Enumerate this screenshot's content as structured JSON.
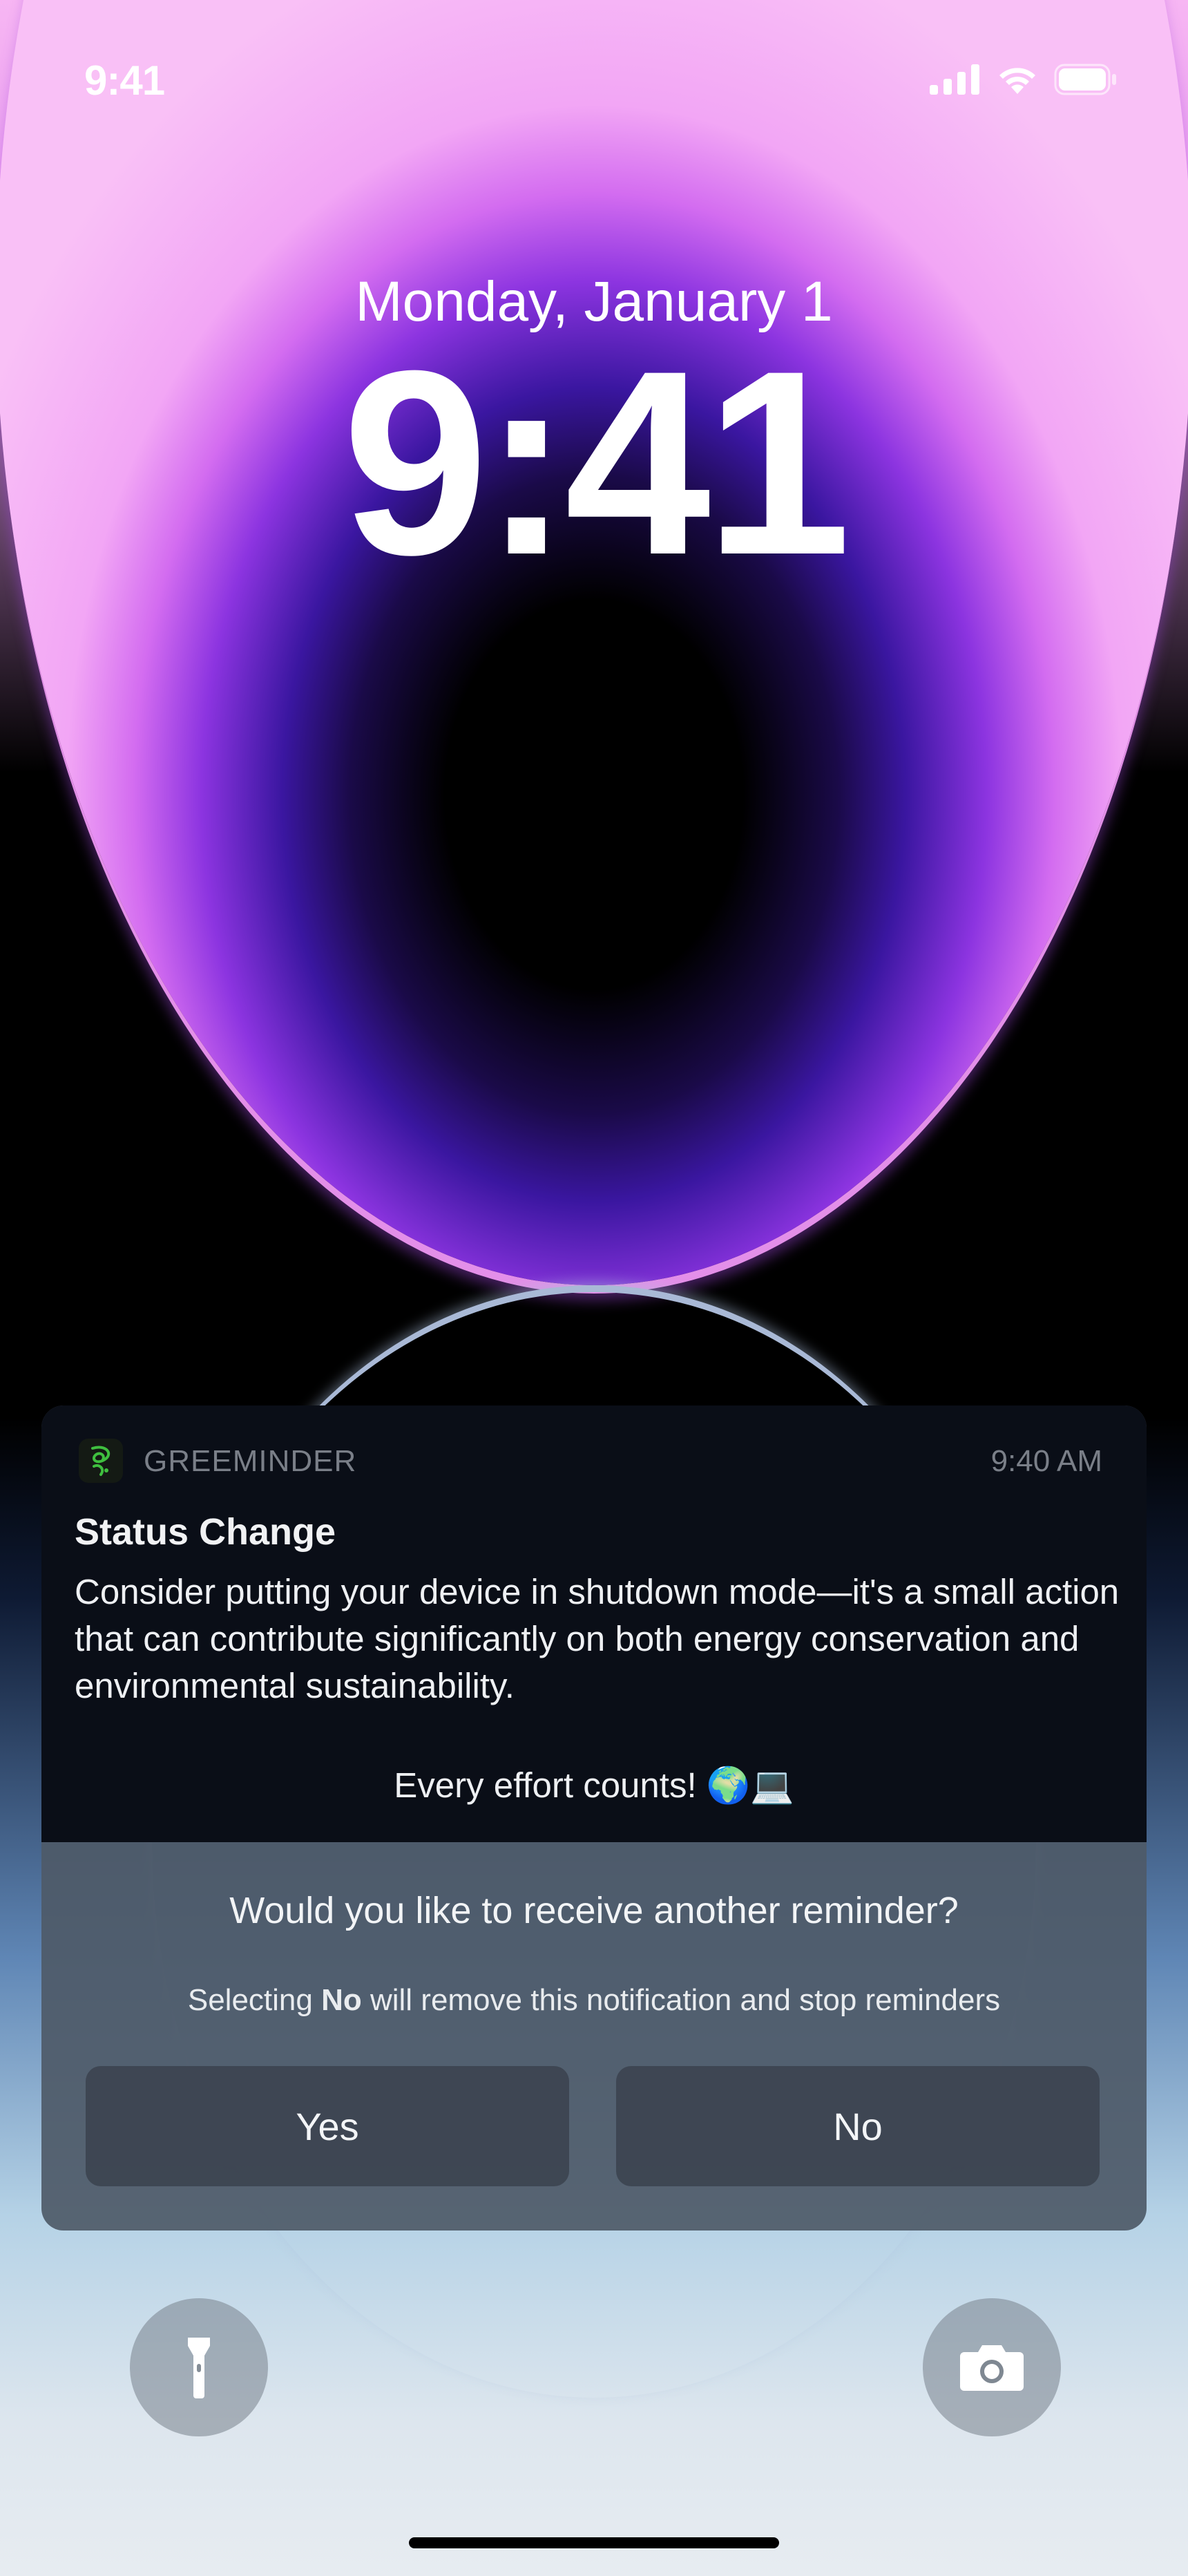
{
  "status_bar": {
    "time": "9:41"
  },
  "lock": {
    "date": "Monday, January 1",
    "time": "9:41"
  },
  "notification": {
    "app_name": "GREEMINDER",
    "time": "9:40 AM",
    "title": "Status Change",
    "body": "Consider putting your device in shutdown mode—it's a small action that can contribute significantly on both energy conservation and environmental sustainability.",
    "extra": "Every effort counts! 🌍💻",
    "question": "Would you like to receive another reminder?",
    "hint_prefix": "Selecting ",
    "hint_bold": "No",
    "hint_suffix": " will remove this notification and stop reminders",
    "yes_label": "Yes",
    "no_label": "No",
    "accent": "#3fbf3f"
  },
  "icons": {
    "cellular": "cellular-signal-icon",
    "wifi": "wifi-icon",
    "battery": "battery-icon",
    "flashlight": "flashlight-icon",
    "camera": "camera-icon",
    "app": "greeminder-app-icon"
  }
}
